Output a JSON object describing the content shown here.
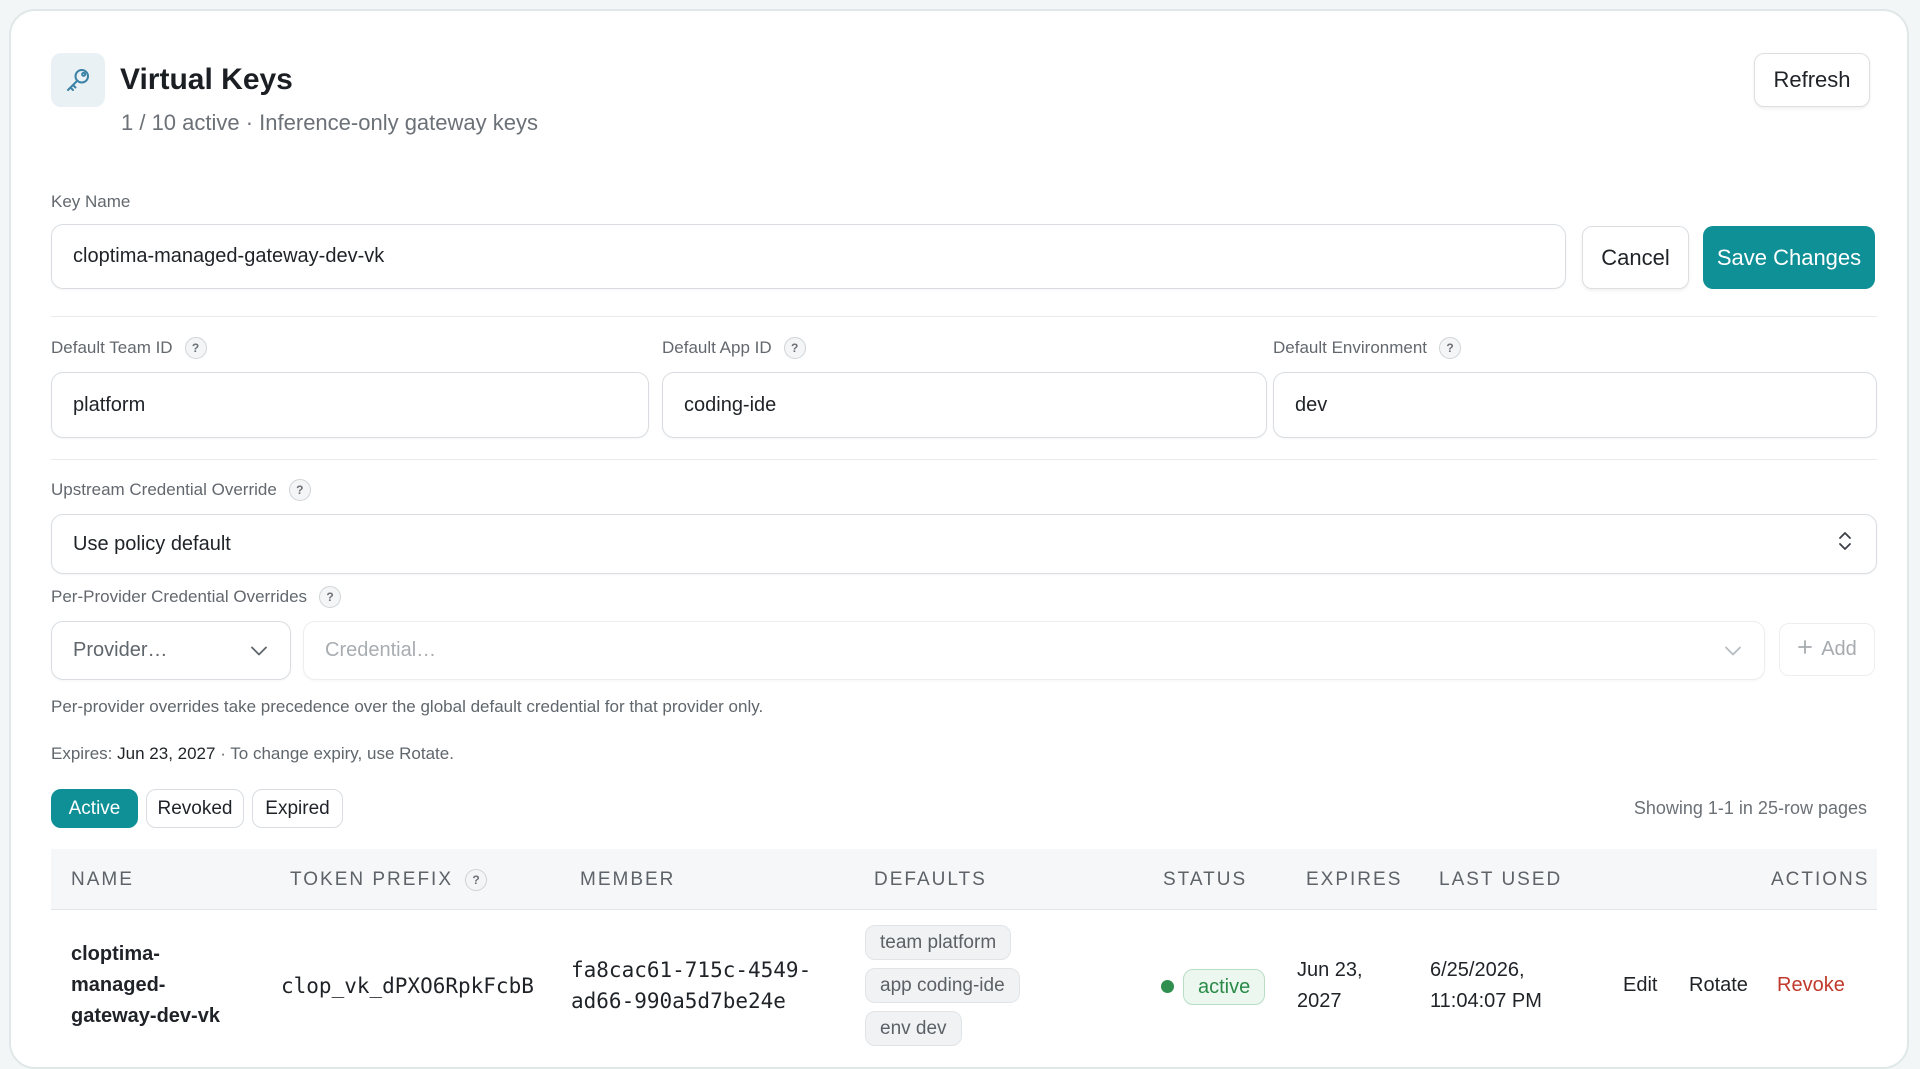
{
  "header": {
    "title": "Virtual Keys",
    "subtitle": "1 / 10 active · Inference-only gateway keys",
    "refresh_label": "Refresh"
  },
  "form": {
    "key_name_label": "Key Name",
    "key_name_value": "cloptima-managed-gateway-dev-vk",
    "cancel_label": "Cancel",
    "save_label": "Save Changes",
    "team_label": "Default Team ID",
    "team_value": "platform",
    "app_label": "Default App ID",
    "app_value": "coding-ide",
    "env_label": "Default Environment",
    "env_value": "dev",
    "upstream_label": "Upstream Credential Override",
    "upstream_value": "Use policy default",
    "per_provider_label": "Per-Provider Credential Overrides",
    "provider_placeholder": "Provider…",
    "credential_placeholder": "Credential…",
    "add_label": "Add",
    "per_provider_note": "Per-provider overrides take precedence over the global default credential for that provider only.",
    "expires_prefix": "Expires:",
    "expires_date": "Jun 23, 2027",
    "expires_suffix": "· To change expiry, use Rotate.",
    "help_glyph": "?"
  },
  "filters": {
    "active": "Active",
    "revoked": "Revoked",
    "expired": "Expired",
    "selected": "Active"
  },
  "paging": "Showing 1-1 in 25-row pages",
  "table": {
    "columns": [
      "NAME",
      "TOKEN PREFIX",
      "MEMBER",
      "DEFAULTS",
      "STATUS",
      "EXPIRES",
      "LAST USED",
      "ACTIONS"
    ],
    "rows": [
      {
        "name_lines": [
          "cloptima-",
          "managed-",
          "gateway-dev-vk"
        ],
        "token_prefix": "clop_vk_dPXO6RpkFcbB",
        "member_lines": [
          "fa8cac61-715c-4549-",
          "ad66-990a5d7be24e"
        ],
        "defaults": [
          "team platform",
          "app coding-ide",
          "env dev"
        ],
        "status": "active",
        "expires_lines": [
          "Jun 23,",
          "2027"
        ],
        "last_used_lines": [
          "6/25/2026,",
          "11:04:07 PM"
        ],
        "actions": [
          "Edit",
          "Rotate",
          "Revoke"
        ]
      }
    ]
  },
  "colors": {
    "accent": "#0f8f96",
    "danger": "#c0392b",
    "success": "#2f8f4e"
  },
  "icons": {
    "header": "key-icon",
    "upstream_select": "chevron-up-down-icon",
    "provider_select": "chevron-down-icon",
    "add": "plus-icon"
  }
}
